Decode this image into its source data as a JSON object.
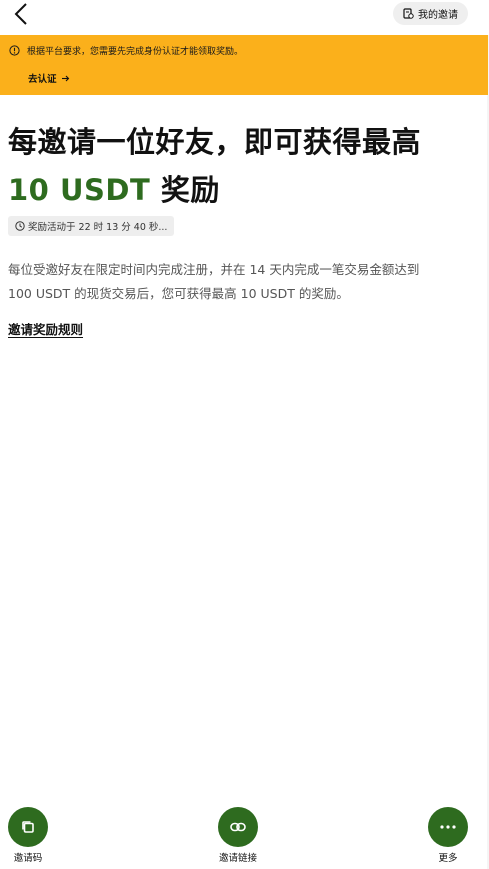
{
  "header": {
    "my_invites_label": "我的邀请"
  },
  "banner": {
    "message": "根据平台要求，您需要先完成身份认证才能领取奖励。",
    "action_label": "去认证",
    "background_color": "#fbb01b"
  },
  "hero": {
    "title_line1": "每邀请一位好友，即可获得最高",
    "amount": "10 USDT",
    "title_suffix": "奖励",
    "accent_color": "#2e6b1f"
  },
  "timer": {
    "text": "奖励活动于 22 时 13 分 40 秒..."
  },
  "description": {
    "line1": "每位受邀好友在限定时间内完成注册，并在 14 天内完成一笔交易金额达到",
    "line2": "100 USDT 的现货交易后，您可获得最高 10 USDT 的奖励。"
  },
  "rules": {
    "link_label": "邀请奖励规则"
  },
  "bottom_actions": [
    {
      "label": "邀请码",
      "icon": "copy-icon"
    },
    {
      "label": "邀请链接",
      "icon": "link-icon"
    },
    {
      "label": "更多",
      "icon": "more-icon"
    }
  ]
}
